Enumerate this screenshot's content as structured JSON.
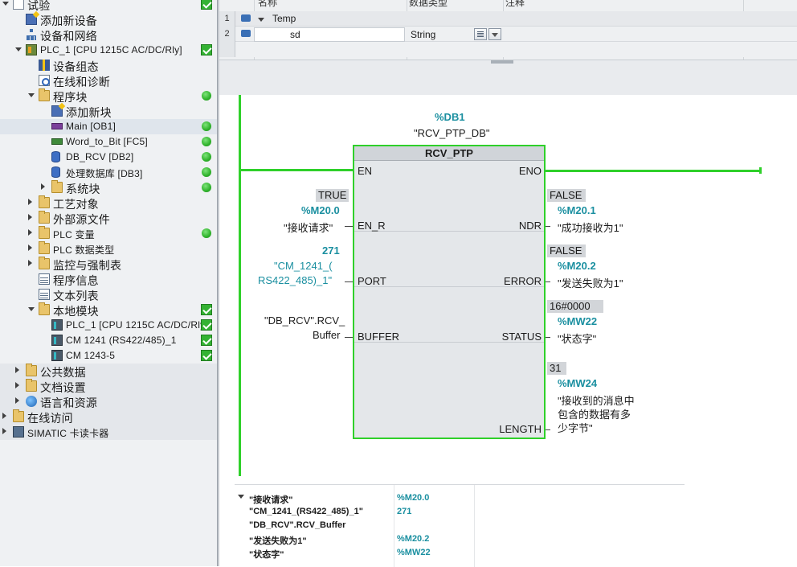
{
  "tree": {
    "items": [
      {
        "label": "试验",
        "indent": 0,
        "expand": "expanded",
        "icon": "project-icon",
        "status": "check"
      },
      {
        "label": "添加新设备",
        "indent": 1,
        "expand": "",
        "icon": "add-device-icon",
        "status": ""
      },
      {
        "label": "设备和网络",
        "indent": 1,
        "expand": "",
        "icon": "network-icon",
        "status": ""
      },
      {
        "label": "PLC_1 [CPU 1215C AC/DC/Rly]",
        "indent": 1,
        "expand": "expanded",
        "icon": "plc-icon",
        "status": "check"
      },
      {
        "label": "设备组态",
        "indent": 2,
        "expand": "",
        "icon": "device-config-icon",
        "status": ""
      },
      {
        "label": "在线和诊断",
        "indent": 2,
        "expand": "",
        "icon": "diagnostics-icon",
        "status": ""
      },
      {
        "label": "程序块",
        "indent": 2,
        "expand": "expanded",
        "icon": "folder-icon",
        "status": "dot"
      },
      {
        "label": "添加新块",
        "indent": 3,
        "expand": "",
        "icon": "add-block-icon",
        "status": ""
      },
      {
        "label": "Main [OB1]",
        "indent": 3,
        "expand": "",
        "icon": "ob-icon",
        "status": "dot",
        "selected": true
      },
      {
        "label": "Word_to_Bit [FC5]",
        "indent": 3,
        "expand": "",
        "icon": "fc-icon",
        "status": "dot"
      },
      {
        "label": "DB_RCV [DB2]",
        "indent": 3,
        "expand": "",
        "icon": "db-icon",
        "status": "dot"
      },
      {
        "label": "处理数据库 [DB3]",
        "indent": 3,
        "expand": "",
        "icon": "db-icon",
        "status": "dot"
      },
      {
        "label": "系统块",
        "indent": 3,
        "expand": "collapsed",
        "icon": "folder-icon",
        "status": "dot"
      },
      {
        "label": "工艺对象",
        "indent": 2,
        "expand": "collapsed",
        "icon": "folder-icon",
        "status": ""
      },
      {
        "label": "外部源文件",
        "indent": 2,
        "expand": "collapsed",
        "icon": "folder-icon",
        "status": ""
      },
      {
        "label": "PLC 变量",
        "indent": 2,
        "expand": "collapsed",
        "icon": "folder-icon",
        "status": "dot"
      },
      {
        "label": "PLC 数据类型",
        "indent": 2,
        "expand": "collapsed",
        "icon": "folder-icon",
        "status": ""
      },
      {
        "label": "监控与强制表",
        "indent": 2,
        "expand": "collapsed",
        "icon": "folder-icon",
        "status": ""
      },
      {
        "label": "程序信息",
        "indent": 2,
        "expand": "",
        "icon": "program-info-icon",
        "status": ""
      },
      {
        "label": "文本列表",
        "indent": 2,
        "expand": "",
        "icon": "text-list-icon",
        "status": ""
      },
      {
        "label": "本地模块",
        "indent": 2,
        "expand": "expanded",
        "icon": "folder-icon",
        "status": "check"
      },
      {
        "label": "PLC_1 [CPU 1215C AC/DC/Rly]",
        "indent": 3,
        "expand": "",
        "icon": "module-icon",
        "status": "check"
      },
      {
        "label": "CM 1241 (RS422/485)_1",
        "indent": 3,
        "expand": "",
        "icon": "module-icon",
        "status": "check"
      },
      {
        "label": "CM 1243-5",
        "indent": 3,
        "expand": "",
        "icon": "module-icon",
        "status": "check"
      },
      {
        "label": "公共数据",
        "indent": 1,
        "expand": "collapsed",
        "icon": "folder-icon",
        "status": "",
        "shaded": true
      },
      {
        "label": "文档设置",
        "indent": 1,
        "expand": "collapsed",
        "icon": "folder-icon",
        "status": "",
        "shaded": true
      },
      {
        "label": "语言和资源",
        "indent": 1,
        "expand": "collapsed",
        "icon": "globe-icon",
        "status": "",
        "shaded": true
      },
      {
        "label": "在线访问",
        "indent": 0,
        "expand": "collapsed",
        "icon": "folder-icon",
        "status": "",
        "shaded": true
      },
      {
        "label": "SIMATIC 卡读卡器",
        "indent": 0,
        "expand": "collapsed",
        "icon": "card-reader-icon",
        "status": "",
        "shaded": true
      }
    ]
  },
  "iface": {
    "headers": {
      "name": "名称",
      "type": "数据类型",
      "comment": "注释"
    },
    "rows": [
      {
        "num": "1",
        "name": "Temp",
        "type": "",
        "comment": ""
      },
      {
        "num": "2",
        "name": "sd",
        "type": "String",
        "comment": ""
      }
    ]
  },
  "block": {
    "db_addr": "%DB1",
    "db_name": "\"RCV_PTP_DB\"",
    "title": "RCV_PTP",
    "pins_in": [
      "EN",
      "EN_R",
      "PORT",
      "BUFFER"
    ],
    "pins_out": [
      "ENO",
      "NDR",
      "ERROR",
      "STATUS",
      "LENGTH"
    ],
    "en_r": {
      "value": "TRUE",
      "addr": "%M20.0",
      "tag": "\"接收请求\""
    },
    "port": {
      "value": "271",
      "tag_l1": "\"CM_1241_(",
      "tag_l2": "RS422_485)_1\""
    },
    "buffer": {
      "tag_l1": "\"DB_RCV\".RCV_",
      "tag_l2": "Buffer"
    },
    "ndr": {
      "value": "FALSE",
      "addr": "%M20.1",
      "tag": "\"成功接收为1\""
    },
    "error": {
      "value": "FALSE",
      "addr": "%M20.2",
      "tag": "\"发送失败为1\""
    },
    "status": {
      "value": "16#0000",
      "addr": "%MW22",
      "tag": "\"状态字\""
    },
    "length": {
      "value": "31",
      "addr": "%MW24",
      "tag_l1": "\"接收到的消息中",
      "tag_l2": "包含的数据有多",
      "tag_l3": "少字节\""
    }
  },
  "info": {
    "rows": [
      {
        "key": "\"接收请求\"",
        "val": "%M20.0"
      },
      {
        "key": "\"CM_1241_(RS422_485)_1\"",
        "val": "271"
      },
      {
        "key": "\"DB_RCV\".RCV_Buffer",
        "val": ""
      },
      {
        "key": "\"发送失败为1\"",
        "val": "%M20.2"
      },
      {
        "key": "\"状态字\"",
        "val": "%MW22"
      }
    ]
  },
  "colors": {
    "accent_green": "#2fd02a",
    "address_cyan": "#1a8fa0"
  }
}
